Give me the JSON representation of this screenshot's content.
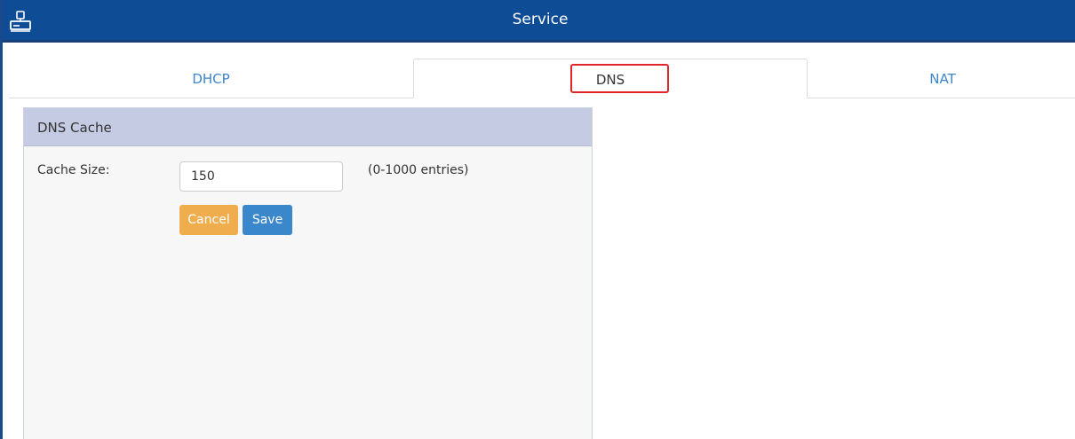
{
  "window": {
    "title": "Service",
    "icon": "router-icon"
  },
  "tabs": [
    {
      "label": "DHCP",
      "active": false
    },
    {
      "label": "DNS",
      "active": true
    },
    {
      "label": "NAT",
      "active": false
    }
  ],
  "dns_cache": {
    "header": "DNS Cache",
    "cache_size_label": "Cache Size:",
    "cache_size_value": "150",
    "cache_size_hint": "(0-1000 entries)",
    "cancel_label": "Cancel",
    "save_label": "Save"
  },
  "colors": {
    "titlebar": "#0e4c96",
    "tab_text": "#3d86c9",
    "highlight": "#e0262b",
    "panel_header": "#c5cbe3",
    "cancel_button": "#efad4e",
    "save_button": "#3a87cc"
  }
}
